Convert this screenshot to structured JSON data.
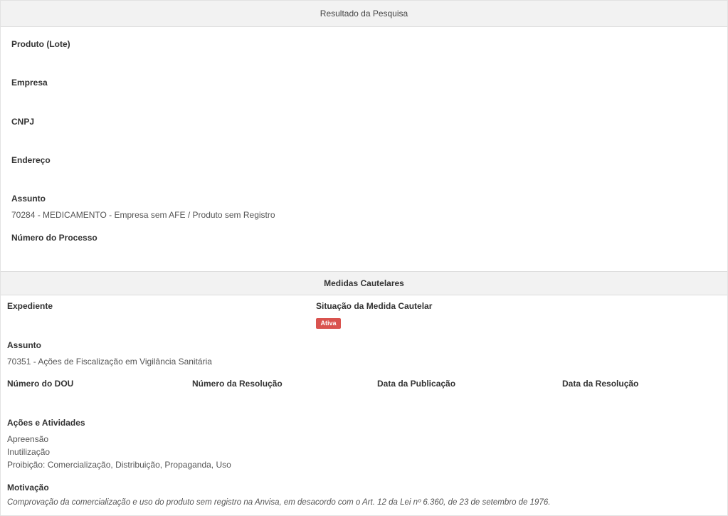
{
  "resultado": {
    "title": "Resultado da Pesquisa",
    "produto_label": "Produto (Lote)",
    "empresa_label": "Empresa",
    "cnpj_label": "CNPJ",
    "endereco_label": "Endereço",
    "assunto_label": "Assunto",
    "assunto_value": "70284 - MEDICAMENTO - Empresa sem AFE / Produto sem Registro",
    "numero_processo_label": "Número do Processo"
  },
  "medidas": {
    "title": "Medidas Cautelares",
    "expediente_label": "Expediente",
    "situacao_label": "Situação da Medida Cautelar",
    "situacao_badge": "Ativa",
    "assunto_label": "Assunto",
    "assunto_value": "70351 - Ações de Fiscalização em Vigilância Sanitária",
    "numero_dou_label": "Número do DOU",
    "numero_resolucao_label": "Número da Resolução",
    "data_publicacao_label": "Data da Publicação",
    "data_resolucao_label": "Data da Resolução",
    "acoes_label": "Ações e Atividades",
    "acoes": [
      "Apreensão",
      "Inutilização",
      "Proibição: Comercialização, Distribuição, Propaganda, Uso"
    ],
    "motivacao_label": "Motivação",
    "motivacao_value": "Comprovação da comercialização e uso do produto sem registro na Anvisa, em desacordo com o Art. 12 da Lei nº 6.360, de 23 de setembro de 1976."
  },
  "colors": {
    "badge": "#d9534f",
    "header_bg": "#f2f2f2"
  }
}
